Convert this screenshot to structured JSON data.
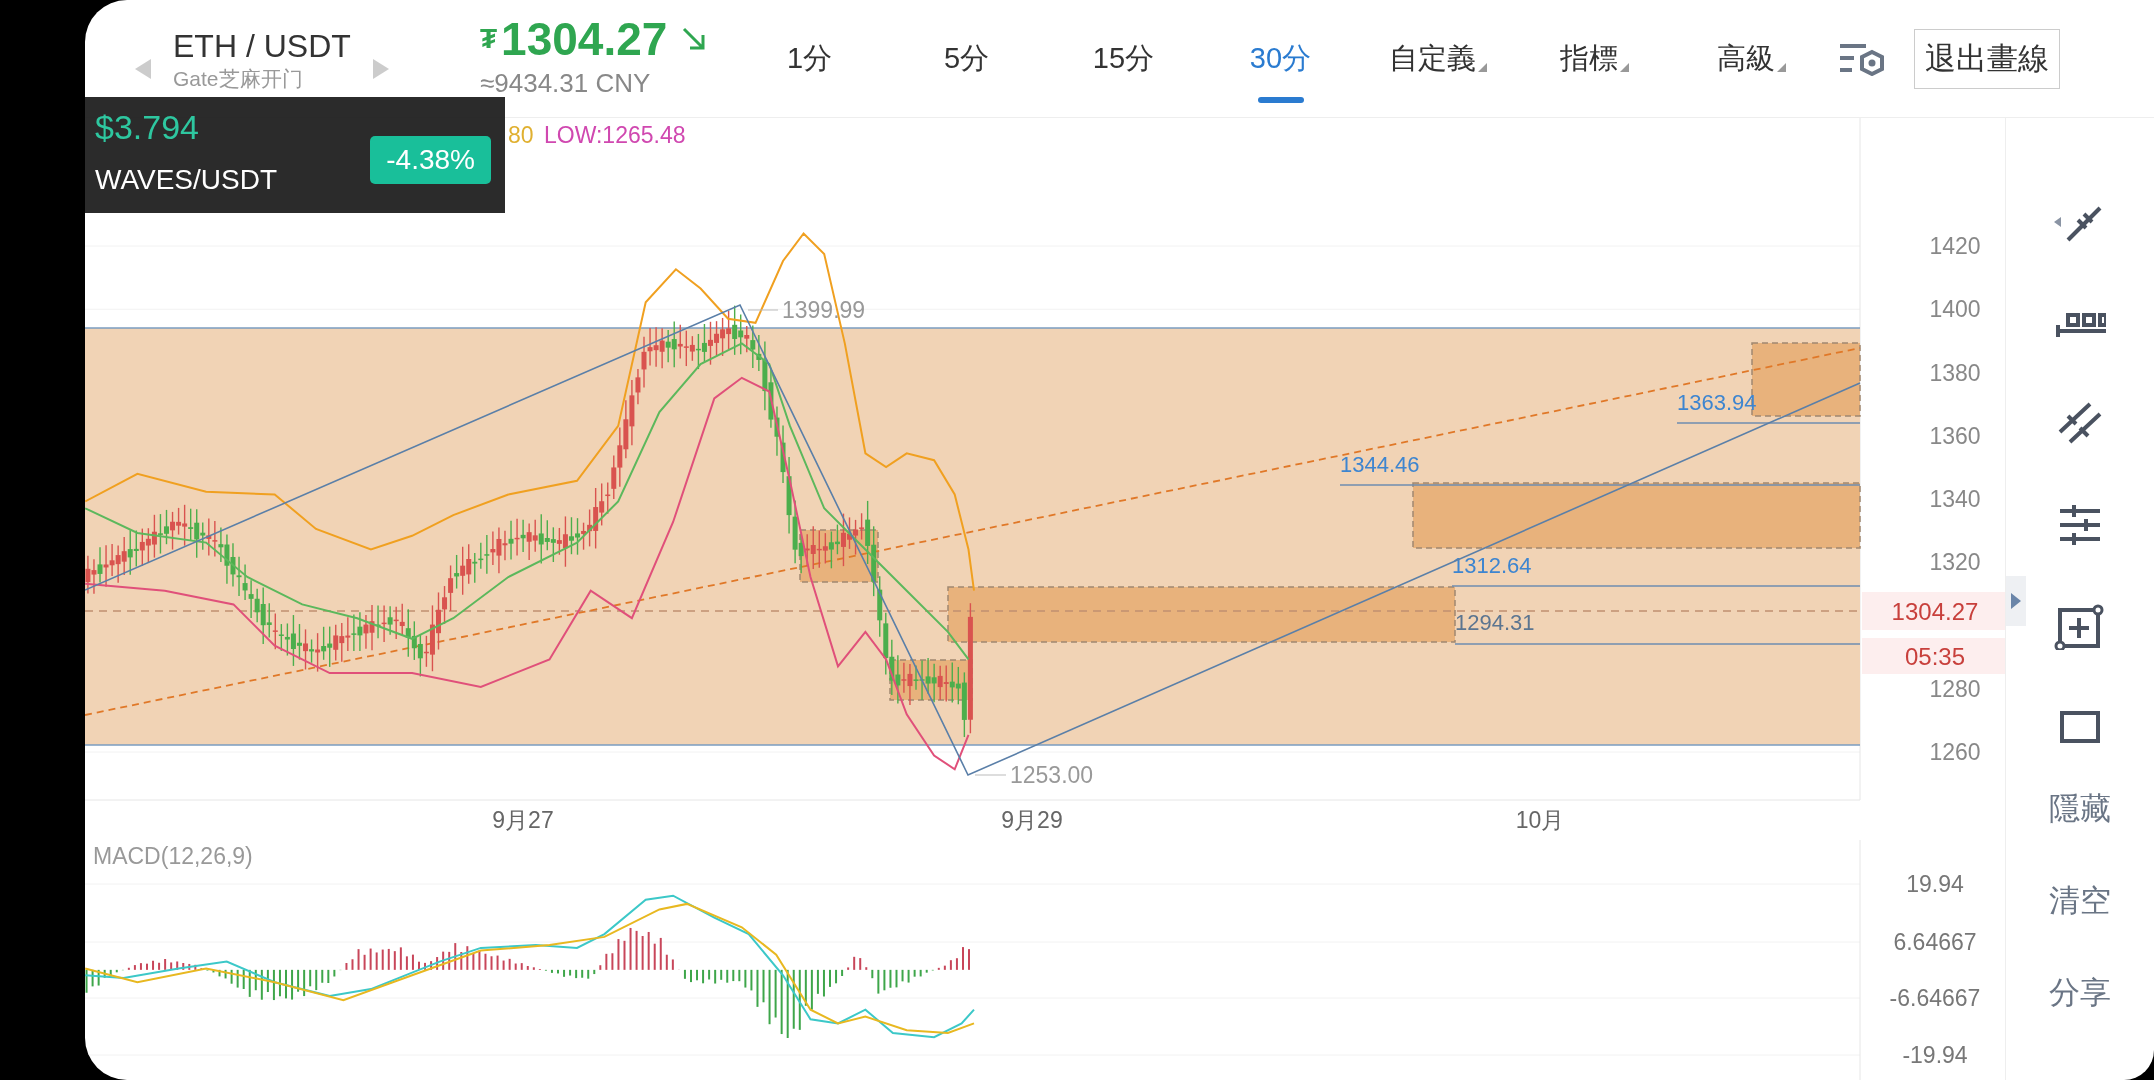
{
  "header": {
    "symbol": "ETH / USDT",
    "exchange": "Gate芝麻开门",
    "currency_sign": "₮",
    "price": "1304.27",
    "cny": "≈9434.31 CNY"
  },
  "intervals": [
    {
      "label": "1分",
      "selected": false
    },
    {
      "label": "5分",
      "selected": false
    },
    {
      "label": "15分",
      "selected": false
    },
    {
      "label": "30分",
      "selected": true
    }
  ],
  "menus": [
    {
      "label": "自定義"
    },
    {
      "label": "指標"
    },
    {
      "label": "高級"
    }
  ],
  "exit_button": "退出畫線",
  "ticker_popup": {
    "price": "$3.794",
    "pair": "WAVES/USDT",
    "change": "-4.38%"
  },
  "boll_legend": [
    {
      "text": "80",
      "color": "#e0b030"
    },
    {
      "text": "LOW:1265.48",
      "color": "#d048b0"
    }
  ],
  "price_chart": {
    "y_labels": [
      "1420",
      "1400",
      "1380",
      "1360",
      "1340",
      "1320",
      "1280",
      "1260"
    ],
    "x_labels": [
      "9月27",
      "9月29",
      "10月"
    ],
    "high_label": "1399.99",
    "low_label": "1253.00",
    "levels": [
      {
        "text": "1363.94",
        "color": "#3d85d0"
      },
      {
        "text": "1344.46",
        "color": "#3d85d0"
      },
      {
        "text": "1312.64",
        "color": "#3d85d0"
      },
      {
        "text": "1294.31",
        "color": "#5c7590"
      }
    ],
    "last_price": "1304.27",
    "countdown": "05:35"
  },
  "macd": {
    "title": "MACD(12,26,9)",
    "y_labels": [
      "19.94",
      "6.64667",
      "-6.64667",
      "-19.94"
    ]
  },
  "toolbar": {
    "actions": [
      "隱藏",
      "清空",
      "分享"
    ]
  }
}
